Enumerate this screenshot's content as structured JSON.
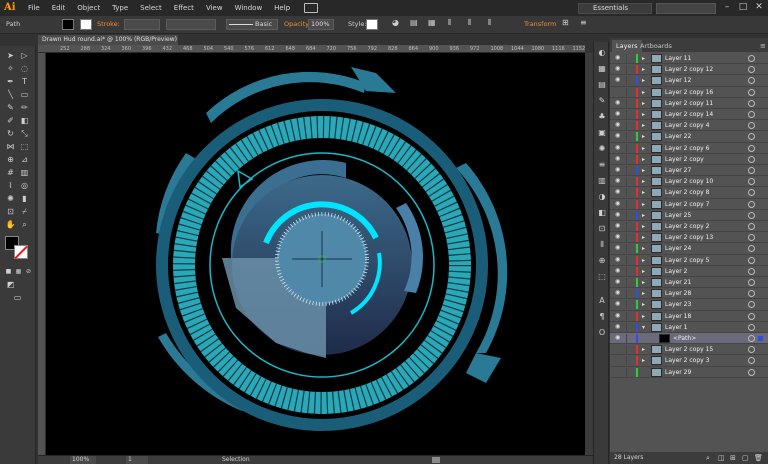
{
  "menubar": {
    "logo": "Ai",
    "items": [
      "File",
      "Edit",
      "Object",
      "Type",
      "Select",
      "Effect",
      "View",
      "Window",
      "Help"
    ],
    "workspace": "Essentials",
    "window_controls": [
      "–",
      "□",
      "✕"
    ]
  },
  "controlbar": {
    "selection_label": "Path",
    "stroke_label": "Stroke:",
    "stroke_profile": "Basic",
    "opacity_label": "Opacity:",
    "opacity_value": "100%",
    "style_label": "Style:",
    "transform_label": "Transform"
  },
  "document": {
    "tab_title": "Drawn Hud round.ai* @ 100% (RGB/Preview)",
    "ruler_ticks": [
      "252",
      "288",
      "324",
      "360",
      "396",
      "432",
      "468",
      "504",
      "540",
      "576",
      "612",
      "648",
      "684",
      "720",
      "756",
      "792",
      "828",
      "864",
      "900",
      "936",
      "972",
      "1008",
      "1044",
      "1080",
      "1116",
      "1152"
    ]
  },
  "statusbar": {
    "zoom": "100%",
    "artboard": "1",
    "tool": "Selection"
  },
  "layers_panel": {
    "tabs": [
      "Layers",
      "Artboards"
    ],
    "rows": [
      {
        "name": "Layer 11",
        "color": "#2ecc40",
        "expand": "▸",
        "eye": true,
        "selected": false
      },
      {
        "name": "Layer 2 copy 12",
        "color": "#e03030",
        "expand": "▸",
        "eye": true,
        "selected": false
      },
      {
        "name": "Layer 12",
        "color": "#3050e0",
        "expand": "▸",
        "eye": true,
        "selected": false
      },
      {
        "name": "Layer 2 copy 16",
        "color": "#e03030",
        "expand": "▸",
        "eye": false,
        "selected": false
      },
      {
        "name": "Layer 2 copy 11",
        "color": "#e03030",
        "expand": "▸",
        "eye": true,
        "selected": false
      },
      {
        "name": "Layer 2 copy 14",
        "color": "#e03030",
        "expand": "▸",
        "eye": true,
        "selected": false
      },
      {
        "name": "Layer 2 copy 4",
        "color": "#e03030",
        "expand": "▸",
        "eye": true,
        "selected": false
      },
      {
        "name": "Layer 22",
        "color": "#2ecc40",
        "expand": "▸",
        "eye": true,
        "selected": false
      },
      {
        "name": "Layer 2 copy 6",
        "color": "#e03030",
        "expand": "▸",
        "eye": true,
        "selected": false
      },
      {
        "name": "Layer 2 copy",
        "color": "#e03030",
        "expand": "▸",
        "eye": true,
        "selected": false
      },
      {
        "name": "Layer 27",
        "color": "#3050e0",
        "expand": "▸",
        "eye": true,
        "selected": false
      },
      {
        "name": "Layer 2 copy 10",
        "color": "#e03030",
        "expand": "▸",
        "eye": true,
        "selected": false
      },
      {
        "name": "Layer 2 copy 8",
        "color": "#e03030",
        "expand": "▸",
        "eye": true,
        "selected": false
      },
      {
        "name": "Layer 2 copy 7",
        "color": "#e03030",
        "expand": "▸",
        "eye": true,
        "selected": false
      },
      {
        "name": "Layer 25",
        "color": "#3050e0",
        "expand": "▸",
        "eye": true,
        "selected": false
      },
      {
        "name": "Layer 2 copy 2",
        "color": "#e03030",
        "expand": "▸",
        "eye": true,
        "selected": false
      },
      {
        "name": "Layer 2 copy 13",
        "color": "#e03030",
        "expand": "▸",
        "eye": true,
        "selected": false
      },
      {
        "name": "Layer 24",
        "color": "#2ecc40",
        "expand": "▸",
        "eye": true,
        "selected": false
      },
      {
        "name": "Layer 2 copy 5",
        "color": "#e03030",
        "expand": "▸",
        "eye": true,
        "selected": false
      },
      {
        "name": "Layer 2",
        "color": "#e03030",
        "expand": "▸",
        "eye": true,
        "selected": false
      },
      {
        "name": "Layer 21",
        "color": "#2ecc40",
        "expand": "▸",
        "eye": true,
        "selected": false
      },
      {
        "name": "Layer 28",
        "color": "#3050e0",
        "expand": "▸",
        "eye": true,
        "selected": false
      },
      {
        "name": "Layer 23",
        "color": "#2ecc40",
        "expand": "▸",
        "eye": true,
        "selected": false
      },
      {
        "name": "Layer 18",
        "color": "#e03030",
        "expand": "▸",
        "eye": true,
        "selected": false
      },
      {
        "name": "Layer 1",
        "color": "#3050e0",
        "expand": "▾",
        "eye": true,
        "selected": false
      },
      {
        "name": "<Path>",
        "color": "#3050e0",
        "expand": "",
        "eye": true,
        "selected": true
      },
      {
        "name": "Layer 2 copy 15",
        "color": "#e03030",
        "expand": "▸",
        "eye": false,
        "selected": false
      },
      {
        "name": "Layer 2 copy 3",
        "color": "#e03030",
        "expand": "▸",
        "eye": false,
        "selected": false
      },
      {
        "name": "Layer 29",
        "color": "#2ecc40",
        "expand": "",
        "eye": false,
        "selected": false
      }
    ],
    "footer": "28 Layers"
  },
  "colors": {
    "hud_dark": "#1f5f7a",
    "hud_mid": "#2f7f9a",
    "hud_cyan": "#00e5ff",
    "hud_panel": "#2b3a5c"
  }
}
